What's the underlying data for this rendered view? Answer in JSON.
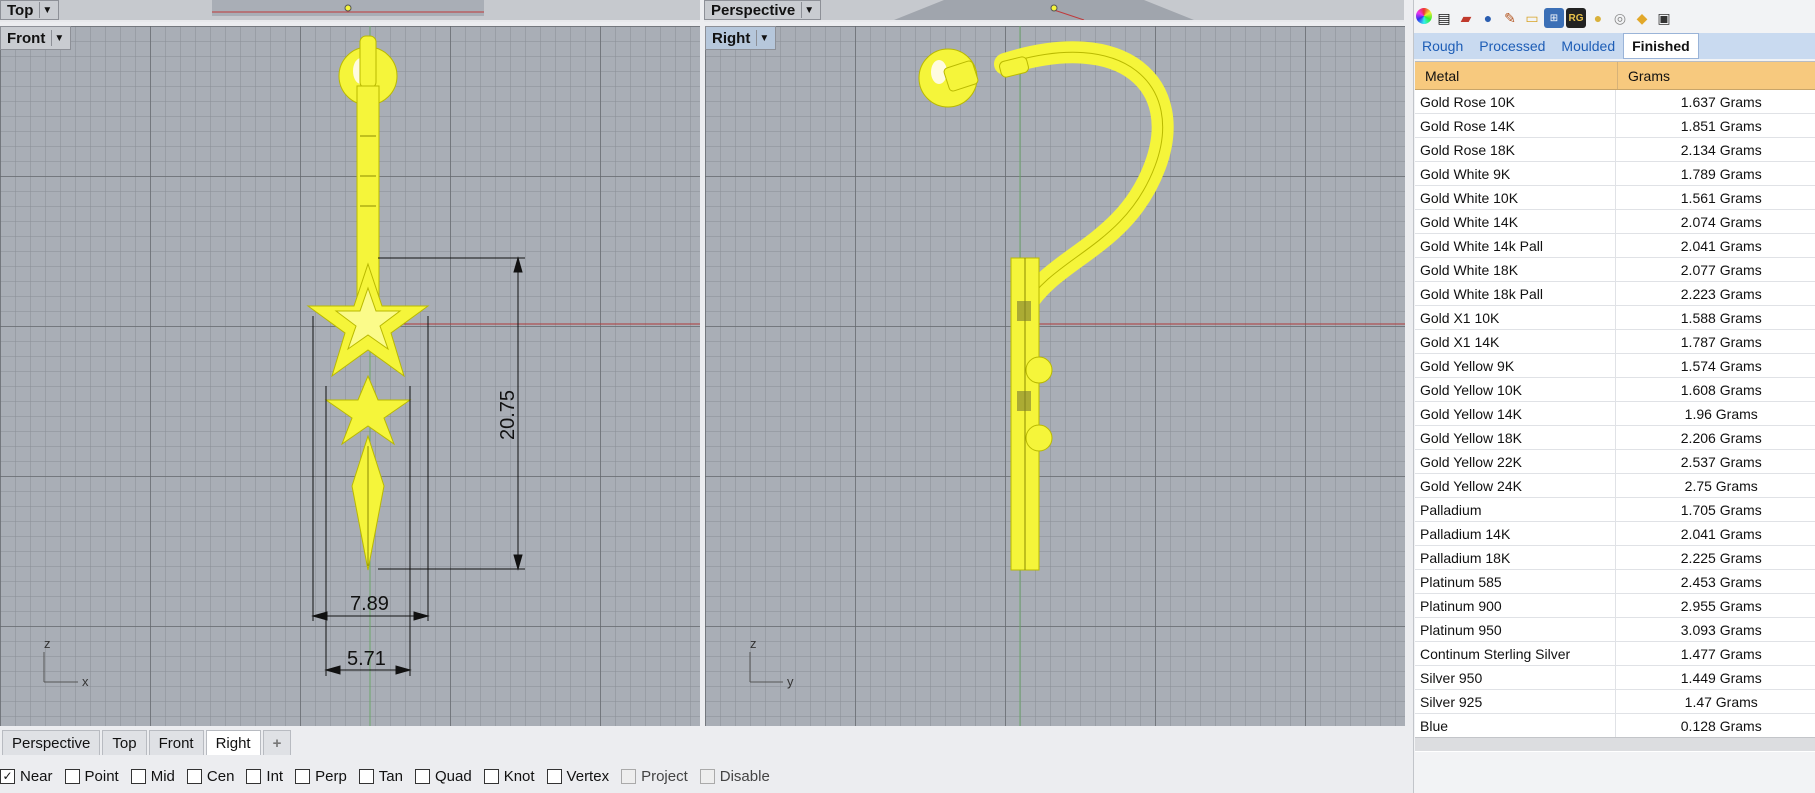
{
  "viewports": {
    "top": {
      "label": "Top"
    },
    "perspective": {
      "label": "Perspective"
    },
    "front": {
      "label": "Front",
      "dim_height": "20.75",
      "dim_width_outer": "7.89",
      "dim_width_inner": "5.71",
      "axis_z": "z",
      "axis_x": "x"
    },
    "right": {
      "label": "Right",
      "axis_z": "z",
      "axis_y": "y"
    }
  },
  "bottom_tabs": [
    "Perspective",
    "Top",
    "Front",
    "Right"
  ],
  "add_tab_symbol": "+",
  "osnaps": [
    {
      "label": "Near",
      "checked": true
    },
    {
      "label": "Point",
      "checked": false
    },
    {
      "label": "Mid",
      "checked": false
    },
    {
      "label": "Cen",
      "checked": false
    },
    {
      "label": "Int",
      "checked": false
    },
    {
      "label": "Perp",
      "checked": false
    },
    {
      "label": "Tan",
      "checked": false
    },
    {
      "label": "Quad",
      "checked": false
    },
    {
      "label": "Knot",
      "checked": false
    },
    {
      "label": "Vertex",
      "checked": false
    },
    {
      "label": "Project",
      "checked": false,
      "disabled": true
    },
    {
      "label": "Disable",
      "checked": false,
      "disabled": true
    }
  ],
  "panel": {
    "icons": [
      "color-wheel-icon",
      "layers-icon",
      "book-icon",
      "globe-icon",
      "brush-icon",
      "folder-icon",
      "properties-icon",
      "rg-icon",
      "gem-icon",
      "compass-icon",
      "gold-icon",
      "display-icon"
    ],
    "rg_text": "RG",
    "subtabs": [
      "Rough",
      "Processed",
      "Moulded",
      "Finished"
    ],
    "active_subtab": "Finished",
    "columns": [
      "Metal",
      "Grams"
    ],
    "rows": [
      [
        "Gold Rose 10K",
        "1.637 Grams"
      ],
      [
        "Gold Rose 14K",
        "1.851 Grams"
      ],
      [
        "Gold Rose 18K",
        "2.134 Grams"
      ],
      [
        "Gold White 9K",
        "1.789 Grams"
      ],
      [
        "Gold White 10K",
        "1.561 Grams"
      ],
      [
        "Gold White 14K",
        "2.074 Grams"
      ],
      [
        "Gold White 14k Pall",
        "2.041 Grams"
      ],
      [
        "Gold White 18K",
        "2.077 Grams"
      ],
      [
        "Gold White 18k Pall",
        "2.223 Grams"
      ],
      [
        "Gold X1 10K",
        "1.588 Grams"
      ],
      [
        "Gold X1 14K",
        "1.787 Grams"
      ],
      [
        "Gold Yellow 9K",
        "1.574 Grams"
      ],
      [
        "Gold Yellow 10K",
        "1.608 Grams"
      ],
      [
        "Gold Yellow 14K",
        "1.96 Grams"
      ],
      [
        "Gold Yellow 18K",
        "2.206 Grams"
      ],
      [
        "Gold Yellow 22K",
        "2.537 Grams"
      ],
      [
        "Gold Yellow 24K",
        "2.75 Grams"
      ],
      [
        "Palladium",
        "1.705 Grams"
      ],
      [
        "Palladium 14K",
        "2.041 Grams"
      ],
      [
        "Palladium 18K",
        "2.225 Grams"
      ],
      [
        "Platinum 585",
        "2.453 Grams"
      ],
      [
        "Platinum 900",
        "2.955 Grams"
      ],
      [
        "Platinum 950",
        "3.093 Grams"
      ],
      [
        "Continum Sterling Silver",
        "1.477 Grams"
      ],
      [
        "Silver 950",
        "1.449 Grams"
      ],
      [
        "Silver 925",
        "1.47 Grams"
      ],
      [
        "Blue",
        "0.128 Grams"
      ]
    ]
  },
  "colors": {
    "viewport_bg": "#a9aeb6",
    "selection": "#f5f53a",
    "header": "#f7c97e",
    "tab_strip": "#c9daf0"
  }
}
